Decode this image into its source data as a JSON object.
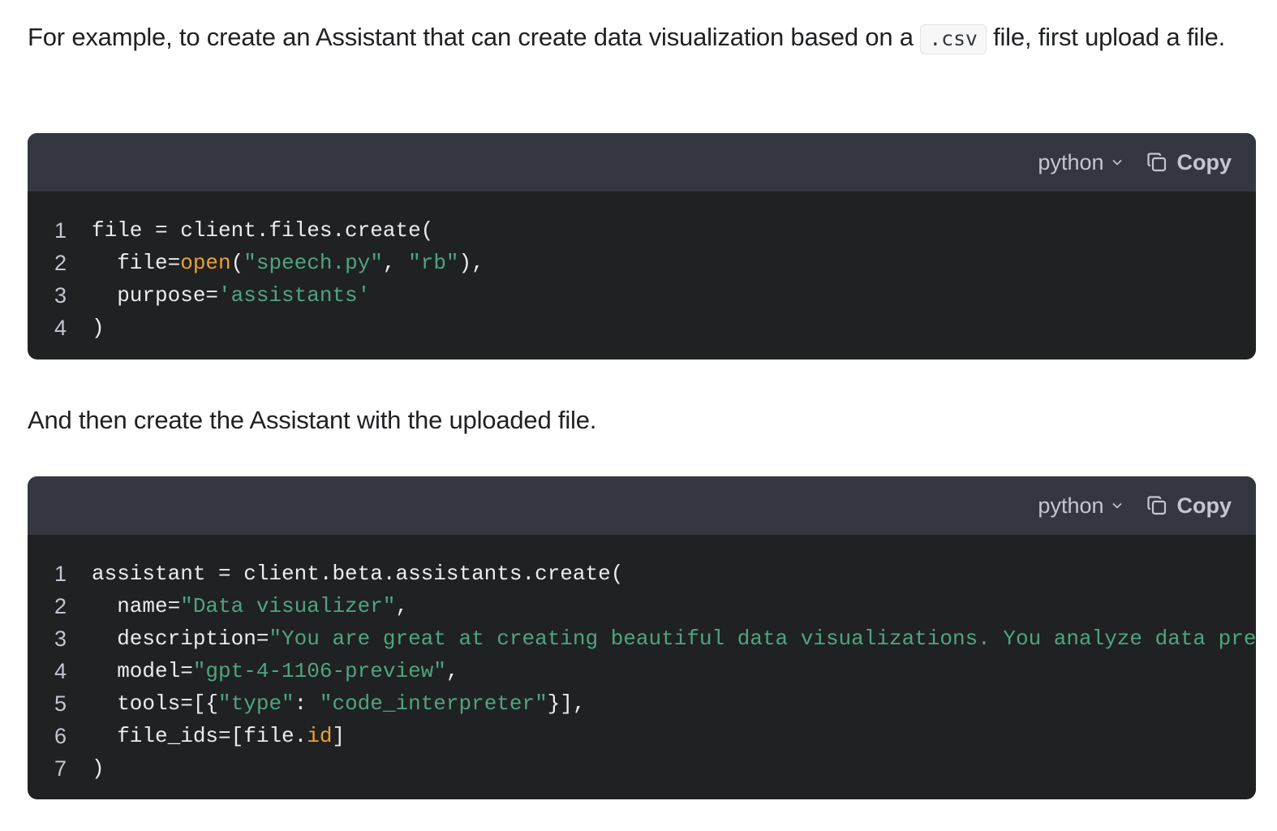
{
  "intro": {
    "before": "For example, to create an Assistant that can create data visualization based on a ",
    "code": ".csv",
    "after": " file, first upload a file."
  },
  "middle_text": "And then create the Assistant with the uploaded file.",
  "code_blocks": [
    {
      "language": "python",
      "copy_label": "Copy",
      "lines": [
        {
          "num": "1",
          "tokens": [
            {
              "t": "plain",
              "v": "file = client.files.create("
            }
          ]
        },
        {
          "num": "2",
          "tokens": [
            {
              "t": "plain",
              "v": "  file="
            },
            {
              "t": "fn",
              "v": "open"
            },
            {
              "t": "plain",
              "v": "("
            },
            {
              "t": "str",
              "v": "\"speech.py\""
            },
            {
              "t": "plain",
              "v": ", "
            },
            {
              "t": "str",
              "v": "\"rb\""
            },
            {
              "t": "plain",
              "v": "),"
            }
          ]
        },
        {
          "num": "3",
          "tokens": [
            {
              "t": "plain",
              "v": "  purpose="
            },
            {
              "t": "str",
              "v": "'assistants'"
            }
          ]
        },
        {
          "num": "4",
          "tokens": [
            {
              "t": "plain",
              "v": ")"
            }
          ]
        }
      ]
    },
    {
      "language": "python",
      "copy_label": "Copy",
      "lines": [
        {
          "num": "1",
          "tokens": [
            {
              "t": "plain",
              "v": "assistant = client.beta.assistants.create("
            }
          ]
        },
        {
          "num": "2",
          "tokens": [
            {
              "t": "plain",
              "v": "  name="
            },
            {
              "t": "str",
              "v": "\"Data visualizer\""
            },
            {
              "t": "plain",
              "v": ","
            }
          ]
        },
        {
          "num": "3",
          "tokens": [
            {
              "t": "plain",
              "v": "  description="
            },
            {
              "t": "str",
              "v": "\"You are great at creating beautiful data visualizations. You analyze data pres"
            }
          ]
        },
        {
          "num": "4",
          "tokens": [
            {
              "t": "plain",
              "v": "  model="
            },
            {
              "t": "str",
              "v": "\"gpt-4-1106-preview\""
            },
            {
              "t": "plain",
              "v": ","
            }
          ]
        },
        {
          "num": "5",
          "tokens": [
            {
              "t": "plain",
              "v": "  tools=[{"
            },
            {
              "t": "str",
              "v": "\"type\""
            },
            {
              "t": "plain",
              "v": ": "
            },
            {
              "t": "str",
              "v": "\"code_interpreter\""
            },
            {
              "t": "plain",
              "v": "}],"
            }
          ]
        },
        {
          "num": "6",
          "tokens": [
            {
              "t": "plain",
              "v": "  file_ids=[file."
            },
            {
              "t": "fn",
              "v": "id"
            },
            {
              "t": "plain",
              "v": "]"
            }
          ]
        },
        {
          "num": "7",
          "tokens": [
            {
              "t": "plain",
              "v": ")"
            }
          ]
        }
      ]
    }
  ],
  "colors": {
    "string": "#4fa580",
    "function": "#e9a23b",
    "code_bg": "#202123",
    "header_bg": "#353740"
  },
  "icons": {
    "chevron": "chevron-down-icon",
    "copy": "copy-icon"
  }
}
